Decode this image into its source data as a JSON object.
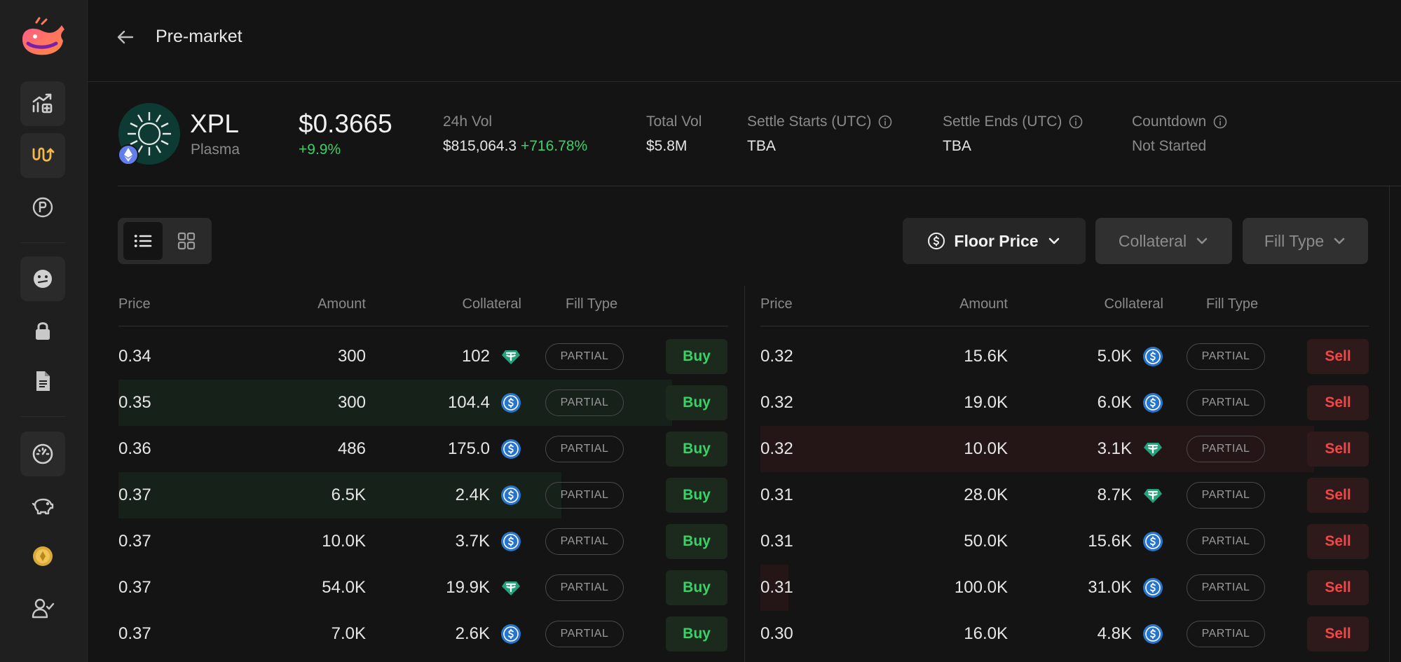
{
  "header": {
    "title": "Pre-market"
  },
  "token": {
    "symbol": "XPL",
    "name": "Plasma",
    "price": "$0.3665",
    "change": "+9.9%"
  },
  "stats": {
    "vol24h": {
      "label": "24h Vol",
      "value": "$815,064.3",
      "change": "+716.78%"
    },
    "total_vol": {
      "label": "Total Vol",
      "value": "$5.8M"
    },
    "settle_starts": {
      "label": "Settle Starts (UTC)",
      "value": "TBA"
    },
    "settle_ends": {
      "label": "Settle Ends (UTC)",
      "value": "TBA"
    },
    "countdown": {
      "label": "Countdown",
      "value": "Not Started"
    }
  },
  "filters": {
    "floor_price": "Floor Price",
    "collateral": "Collateral",
    "fill_type": "Fill Type"
  },
  "columns": {
    "price": "Price",
    "amount": "Amount",
    "collateral": "Collateral",
    "fill_type": "Fill Type"
  },
  "buy_orders": [
    {
      "price": "0.34",
      "amount": "300",
      "collateral": "102",
      "coin": "usdt",
      "fill": "PARTIAL",
      "action": "Buy",
      "depth": 0
    },
    {
      "price": "0.35",
      "amount": "300",
      "collateral": "104.4",
      "coin": "usdc",
      "fill": "PARTIAL",
      "action": "Buy",
      "depth": 1.0
    },
    {
      "price": "0.36",
      "amount": "486",
      "collateral": "175.0",
      "coin": "usdc",
      "fill": "PARTIAL",
      "action": "Buy",
      "depth": 0
    },
    {
      "price": "0.37",
      "amount": "6.5K",
      "collateral": "2.4K",
      "coin": "usdc",
      "fill": "PARTIAL",
      "action": "Buy",
      "depth": 0.8
    },
    {
      "price": "0.37",
      "amount": "10.0K",
      "collateral": "3.7K",
      "coin": "usdc",
      "fill": "PARTIAL",
      "action": "Buy",
      "depth": 0
    },
    {
      "price": "0.37",
      "amount": "54.0K",
      "collateral": "19.9K",
      "coin": "usdt",
      "fill": "PARTIAL",
      "action": "Buy",
      "depth": 0
    },
    {
      "price": "0.37",
      "amount": "7.0K",
      "collateral": "2.6K",
      "coin": "usdc",
      "fill": "PARTIAL",
      "action": "Buy",
      "depth": 0
    }
  ],
  "sell_orders": [
    {
      "price": "0.32",
      "amount": "15.6K",
      "collateral": "5.0K",
      "coin": "usdc",
      "fill": "PARTIAL",
      "action": "Sell",
      "depth": 0
    },
    {
      "price": "0.32",
      "amount": "19.0K",
      "collateral": "6.0K",
      "coin": "usdc",
      "fill": "PARTIAL",
      "action": "Sell",
      "depth": 0
    },
    {
      "price": "0.32",
      "amount": "10.0K",
      "collateral": "3.1K",
      "coin": "usdt",
      "fill": "PARTIAL",
      "action": "Sell",
      "depth": 1.0
    },
    {
      "price": "0.31",
      "amount": "28.0K",
      "collateral": "8.7K",
      "coin": "usdt",
      "fill": "PARTIAL",
      "action": "Sell",
      "depth": 0
    },
    {
      "price": "0.31",
      "amount": "50.0K",
      "collateral": "15.6K",
      "coin": "usdc",
      "fill": "PARTIAL",
      "action": "Sell",
      "depth": 0
    },
    {
      "price": "0.31",
      "amount": "100.0K",
      "collateral": "31.0K",
      "coin": "usdc",
      "fill": "PARTIAL",
      "action": "Sell",
      "depth": 0.05
    },
    {
      "price": "0.30",
      "amount": "16.0K",
      "collateral": "4.8K",
      "coin": "usdc",
      "fill": "PARTIAL",
      "action": "Sell",
      "depth": 0
    }
  ],
  "sidebar": {
    "items": [
      {
        "icon": "chart-icon"
      },
      {
        "icon": "premarket-icon",
        "active": true
      },
      {
        "icon": "points-icon"
      },
      {
        "icon": "emoji-icon"
      },
      {
        "icon": "lock-icon"
      },
      {
        "icon": "document-icon"
      },
      {
        "icon": "dashboard-icon"
      },
      {
        "icon": "piggy-bank-icon"
      },
      {
        "icon": "coin-icon"
      },
      {
        "icon": "user-check-icon"
      }
    ]
  },
  "colors": {
    "accent_green": "#3ccf6a",
    "accent_red": "#f04848",
    "active_icon": "#f2b84b",
    "usdc": "#2775ca",
    "usdt": "#26a17b"
  }
}
